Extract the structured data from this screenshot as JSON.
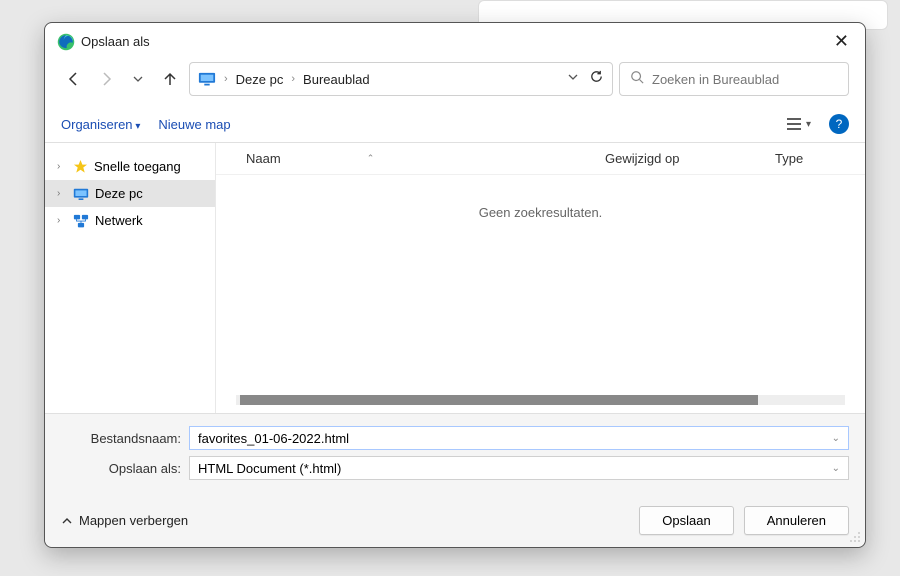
{
  "title": "Opslaan als",
  "nav": {
    "breadcrumb": [
      "Deze pc",
      "Bureaublad"
    ],
    "search_placeholder": "Zoeken in Bureaublad"
  },
  "toolbar": {
    "organiseren": "Organiseren",
    "nieuwe_map": "Nieuwe map"
  },
  "tree": {
    "items": [
      {
        "label": "Snelle toegang",
        "icon": "star",
        "selected": false
      },
      {
        "label": "Deze pc",
        "icon": "monitor",
        "selected": true
      },
      {
        "label": "Netwerk",
        "icon": "network",
        "selected": false
      }
    ]
  },
  "columns": {
    "name": "Naam",
    "modified": "Gewijzigd op",
    "type": "Type"
  },
  "empty_message": "Geen zoekresultaten.",
  "form": {
    "filename_label": "Bestandsnaam:",
    "filename_value": "favorites_01-06-2022.html",
    "saveas_label": "Opslaan als:",
    "saveas_value": "HTML Document (*.html)"
  },
  "footer": {
    "hide_folders": "Mappen verbergen",
    "save": "Opslaan",
    "cancel": "Annuleren"
  }
}
